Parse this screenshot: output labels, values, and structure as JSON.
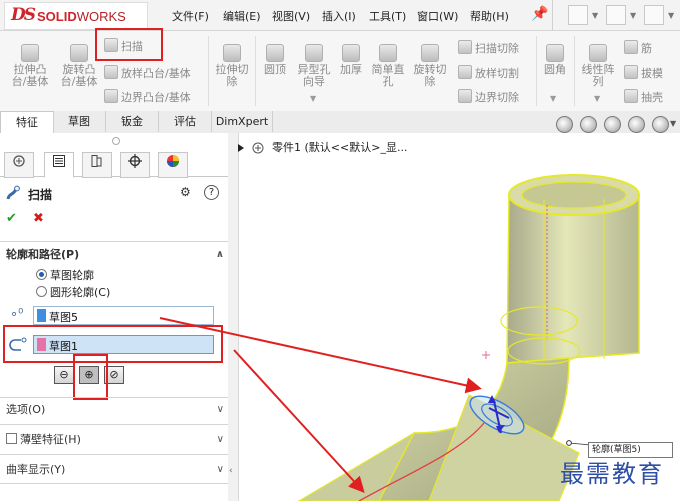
{
  "app": {
    "logo_ds": "DS",
    "logo_solid": "SOLID",
    "logo_works": "WORKS"
  },
  "menu": [
    "文件(F)",
    "编辑(E)",
    "视图(V)",
    "插入(I)",
    "工具(T)",
    "窗口(W)",
    "帮助(H)"
  ],
  "ribbon": {
    "extrude_boss": "拉伸凸\n台/基体",
    "revolve_boss": "旋转凸\n台/基体",
    "sweep": "扫描",
    "loft_boss": "放样凸台/基体",
    "boundary_boss": "边界凸台/基体",
    "extrude_cut": "拉伸切\n除",
    "dome": "圆顶",
    "hole_wizard": "异型孔\n向导",
    "thicken": "加厚",
    "simple_hole": "简单直\n孔",
    "revolve_cut": "旋转切\n除",
    "swept_cut": "扫描切除",
    "lofted_cut": "放样切割",
    "boundary_cut": "边界切除",
    "fillet": "圆角",
    "linear_pattern": "线性阵\n列",
    "rib": "筋",
    "draft": "拔模",
    "shell": "抽壳"
  },
  "tabs": [
    "特征",
    "草图",
    "钣金",
    "评估",
    "DimXpert"
  ],
  "panel": {
    "title": "扫描",
    "help_icon": "?",
    "ok": "✔",
    "cancel": "✖",
    "section_profile_path": "轮廓和路径(P)",
    "radio_sketch_profile": "草图轮廓",
    "radio_circular_profile": "圆形轮廓(C)",
    "profile_value": "草图5",
    "path_value": "草图1",
    "section_options": "选项(O)",
    "section_thin": "薄壁特征(H)",
    "section_curvature": "曲率显示(Y)"
  },
  "tree": {
    "part_name": "零件1",
    "config": "(默认<<默认>_显..."
  },
  "graphics": {
    "profile_label": "轮廓(草图5)",
    "watermark": "最需教育"
  },
  "colors": {
    "accent_red": "#e02020",
    "brand_red": "#d0242b",
    "path_swatch": "#e673a8",
    "profile_swatch": "#3d8fe0"
  }
}
